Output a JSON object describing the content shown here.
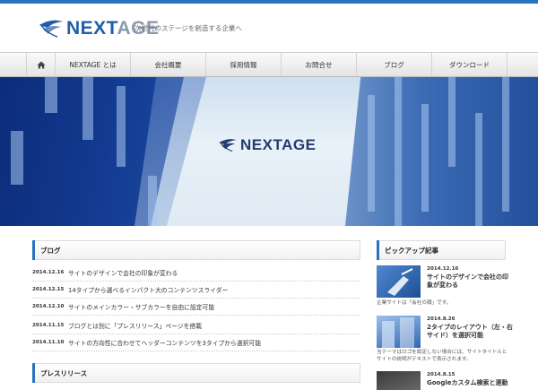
{
  "header": {
    "logo_part1": "NEXT",
    "logo_part2": "AGE",
    "tagline": "次世代のステージを創造する企業へ"
  },
  "nav": {
    "items": [
      "NEXTAGE とは",
      "会社概要",
      "採用情報",
      "お問合せ",
      "ブログ",
      "ダウンロード"
    ]
  },
  "hero": {
    "logo_text": "NEXTAGE"
  },
  "blog": {
    "heading": "ブログ",
    "posts": [
      {
        "date": "2014.12.16",
        "title": "サイトのデザインで会社の印象が変わる"
      },
      {
        "date": "2014.12.15",
        "title": "14タイプから選べるインパクト大のコンテンツスライダー"
      },
      {
        "date": "2014.12.10",
        "title": "サイトのメインカラー・サブカラーを自由に設定可能"
      },
      {
        "date": "2014.11.15",
        "title": "ブログとは別に「プレスリリース」ページを搭載"
      },
      {
        "date": "2014.11.10",
        "title": "サイトの方向性に合わせてヘッダーコンテンツを3タイプから選択可能"
      }
    ]
  },
  "press": {
    "heading": "プレスリリース"
  },
  "pickup": {
    "heading": "ピックアップ記事",
    "items": [
      {
        "date": "2014.12.16",
        "title": "サイトのデザインで会社の印象が変わる",
        "desc": "企業サイトは「会社の顔」です。"
      },
      {
        "date": "2014.8.26",
        "title": "2タイプのレイアウト（左・右サイド）を選択可能",
        "desc": "当テーマはロゴを設定しない場合には、サイトタイトルとサイトの説明がテキストで表示されます。"
      },
      {
        "date": "2014.8.15",
        "title": "Googleカスタム検索と連動",
        "desc": ""
      }
    ]
  },
  "colors": {
    "accent": "#2a72c0",
    "brand_dark": "#1f5fa8"
  }
}
